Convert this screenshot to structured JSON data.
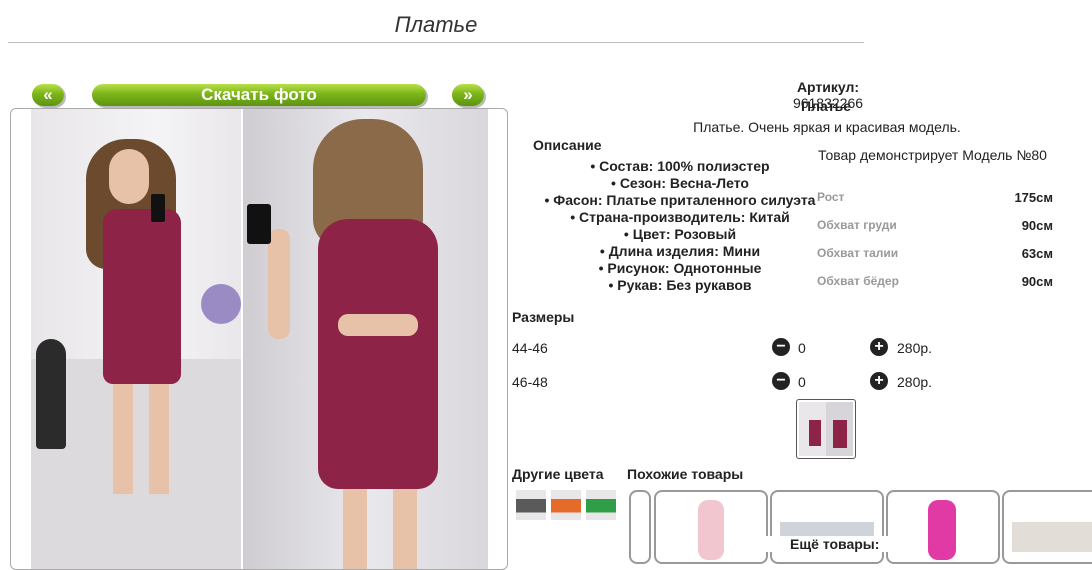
{
  "page": {
    "title": "Платье"
  },
  "gallery": {
    "prev_label": "«",
    "next_label": "»",
    "download_label": "Скачать фото"
  },
  "product": {
    "article_label": "Артикул:",
    "article_value": "961832266",
    "name": "Платье",
    "short_desc": "Платье. Очень яркая и красивая модель.",
    "description_title": "Описание",
    "properties": [
      "• Состав: 100% полиэстер",
      "• Сезон: Весна-Лето",
      "• Фасон: Платье приталенного силуэта",
      "• Страна-производитель: Китай",
      "• Цвет: Розовый",
      "• Длина изделия: Мини",
      "• Рисунок: Однотонные",
      "• Рукав: Без рукавов"
    ]
  },
  "model": {
    "title": "Товар демонстрирует Модель №80",
    "measurements": [
      {
        "label": "Рост",
        "value": "175см"
      },
      {
        "label": "Обхват груди",
        "value": "90см"
      },
      {
        "label": "Обхват талии",
        "value": "63см"
      },
      {
        "label": "Обхват бёдер",
        "value": "90см"
      }
    ]
  },
  "sizes": {
    "title": "Размеры",
    "rows": [
      {
        "size": "44-46",
        "minus": "−",
        "qty": "0",
        "plus": "+",
        "price": "280р."
      },
      {
        "size": "46-48",
        "minus": "−",
        "qty": "0",
        "plus": "+",
        "price": "280р."
      }
    ]
  },
  "bottom": {
    "other_colors_title": "Другие цвета",
    "similar_title": "Похожие товары",
    "more_title": "Ещё товары:"
  },
  "colors": {
    "dress": "#8d2448",
    "button_green": "#6fa817"
  }
}
